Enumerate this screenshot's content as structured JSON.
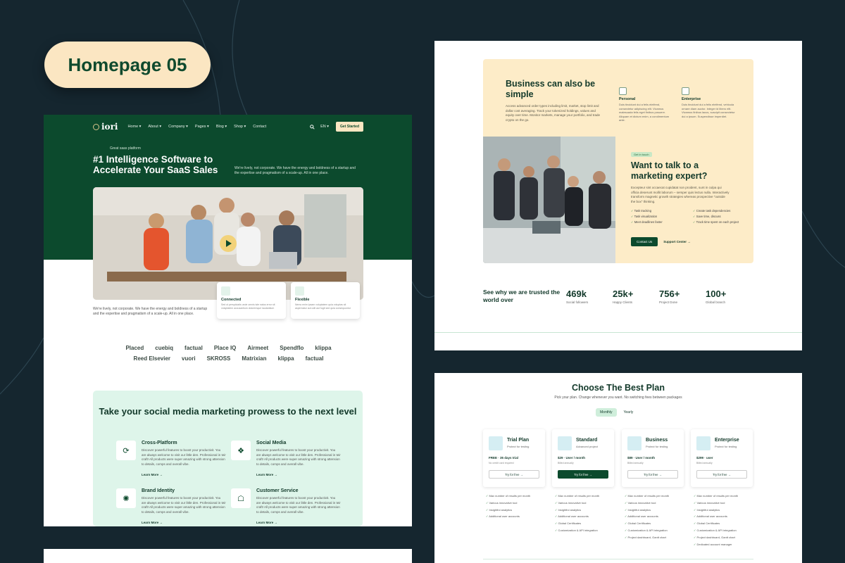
{
  "badge": "Homepage 05",
  "home": {
    "logo": "iori",
    "nav": [
      "Home ▾",
      "About ▾",
      "Company ▾",
      "Pages ▾",
      "Blog ▾",
      "Shop ▾",
      "Contact"
    ],
    "search_icon": "search-icon",
    "lang": "EN ▾",
    "get_started": "Get Started",
    "pill": "Great saas platform",
    "title": "#1 Intelligence Software to Accelerate Your SaaS Sales",
    "intro": "We're lively, not corporate. We have the energy and boldness of a startup and the expertise and pragmatism of a scale-up. All in one place.",
    "left_text": "We're lively, not corporate. We have the energy and boldness of a startup and the expertise and pragmatism of a scale-up. All in one place.",
    "features": [
      {
        "title": "Connected",
        "desc": "Sed ut perspiciatis unde omnis iste natus error sit voluptatem accusantium doloremque laudantium"
      },
      {
        "title": "Flexible",
        "desc": "Nemo enim ipsam voluptatem quia voluptas sit aspernatur aut odit aut fugit sed quia consequuntur"
      }
    ],
    "logos": [
      "Placed",
      "cuebiq",
      "factual",
      "Place IQ",
      "Airmeet",
      "Spendflo",
      "klippa",
      "Reed Elsevier",
      "vuori",
      "SKROSS",
      "Matrixian",
      "klippa",
      "factual"
    ],
    "social": {
      "title": "Take your social media marketing prowess to the next level",
      "items": [
        {
          "title": "Cross-Platform",
          "desc": "Discover powerful features to boost your productivit. You are always welcome to visit our little den. Professional in teir craft! All products were super amazing with strong attension to details, comps and overall vibe.",
          "link": "Learn More →"
        },
        {
          "title": "Social Media",
          "desc": "Discover powerful features to boost your productivit. You are always welcome to visit our little den. Professional in teir craft! All products were super amazing with strong attension to details, comps and overall vibe.",
          "link": "Learn More →"
        },
        {
          "title": "Brand Identity",
          "desc": "Discover powerful features to boost your productivit. You are always welcome to visit our little den. Professional in teir craft! All products were super amazing with strong attension to details, comps and overall vibe.",
          "link": "Learn More →"
        },
        {
          "title": "Customer Service",
          "desc": "Discover powerful features to boost your productivit. You are always welcome to visit our little den. Professional in teir craft! All products were super amazing with strong attension to details, comps and overall vibe.",
          "link": "Learn More →"
        }
      ]
    }
  },
  "business": {
    "title": "Business can also be simple",
    "desc": "Access advanced order types including limit, market, stop limit and dollar cost averaging. Track your tokenized holdings, values and equity over time. Monitor markets, manage your portfolio, and trade crypto on the go.",
    "tiers": [
      {
        "title": "Personal",
        "desc": "Duis tincidunt dui a felis eleifend, consectetur adipiscing elit. Vivamus malesuada felis eget finibus posuere. Aliquam et dictum enim, a condimentum ante."
      },
      {
        "title": "Enterprise",
        "desc": "Duis tincidunt dui a felis eleifend, vehicula ornare diam auctor. Integer id libero elit. Vivamus finibus lacus, suscipit consectetur dui a ipsum. Suspendisse imperdiet."
      }
    ],
    "tag": "Get in touch",
    "talk": "Want to talk to a marketing expert?",
    "talk_desc": "Excepteur sint occaecat cupidatat non proident, sunt in culpa qui officia deserunt mollit laborum – semper quis lectus nulla. Interactively transform magnetic growth strategies whereas prospective \"outside the box\" thinking.",
    "checks": [
      "Task tracking",
      "Create task dependencies",
      "Task visualization",
      "Save time, discuss",
      "Meet deadlines faster",
      "Track time spent on each project"
    ],
    "contact": "Contact Us",
    "support": "Support Center →",
    "stats_lead": "See why we are trusted the world over",
    "stats": [
      {
        "n": "469k",
        "l": "Social followers"
      },
      {
        "n": "25k+",
        "l": "Happy Clients"
      },
      {
        "n": "756+",
        "l": "Project Done"
      },
      {
        "n": "100+",
        "l": "Global branch"
      }
    ]
  },
  "pricing": {
    "title": "Choose The Best Plan",
    "subtitle": "Pick your plan. Change whenever you want. No switching fees between packages",
    "toggle": [
      "Monthly",
      "Yearly"
    ],
    "plans": [
      {
        "name": "Trial Plan",
        "sub": "Protect for testing",
        "price": "FREE · 35 days trial",
        "note": "No credit card required",
        "cta": "Try for free →"
      },
      {
        "name": "Standard",
        "sub": "Advanced project",
        "price": "$29 · User / month",
        "note": "Billed annually",
        "cta": "Try for free →"
      },
      {
        "name": "Business",
        "sub": "Protect for testing",
        "price": "$89 · User / month",
        "note": "Billed annually",
        "cta": "Try for free →"
      },
      {
        "name": "Enterprise",
        "sub": "Protect for testing",
        "price": "$299 · user",
        "note": "Billed annually",
        "cta": "Try for free →"
      }
    ],
    "features": [
      [
        "Max number of results per month",
        "Various innovative tool",
        "Insightful analytics",
        "Additional user accounts"
      ],
      [
        "Max number of results per month",
        "Various innovative tool",
        "Insightful analytics",
        "Additional user accounts",
        "Global Certificates",
        "Customization & API integration"
      ],
      [
        "Max number of results per month",
        "Various innovative tool",
        "Insightful analytics",
        "Additional user accounts",
        "Global Certificates",
        "Customization & API integration",
        "Project dashboard, Gantt chart"
      ],
      [
        "Max number of results per month",
        "Various innovative tool",
        "Insightful analytics",
        "Additional user accounts",
        "Global Certificates",
        "Customization & API integration",
        "Project dashboard, Gantt chart",
        "Dedicated account manager"
      ]
    ]
  },
  "colors": {
    "bg": "#15262f",
    "brand": "#0c4a2d",
    "cream": "#fdecc8",
    "mint": "#def5ea"
  }
}
